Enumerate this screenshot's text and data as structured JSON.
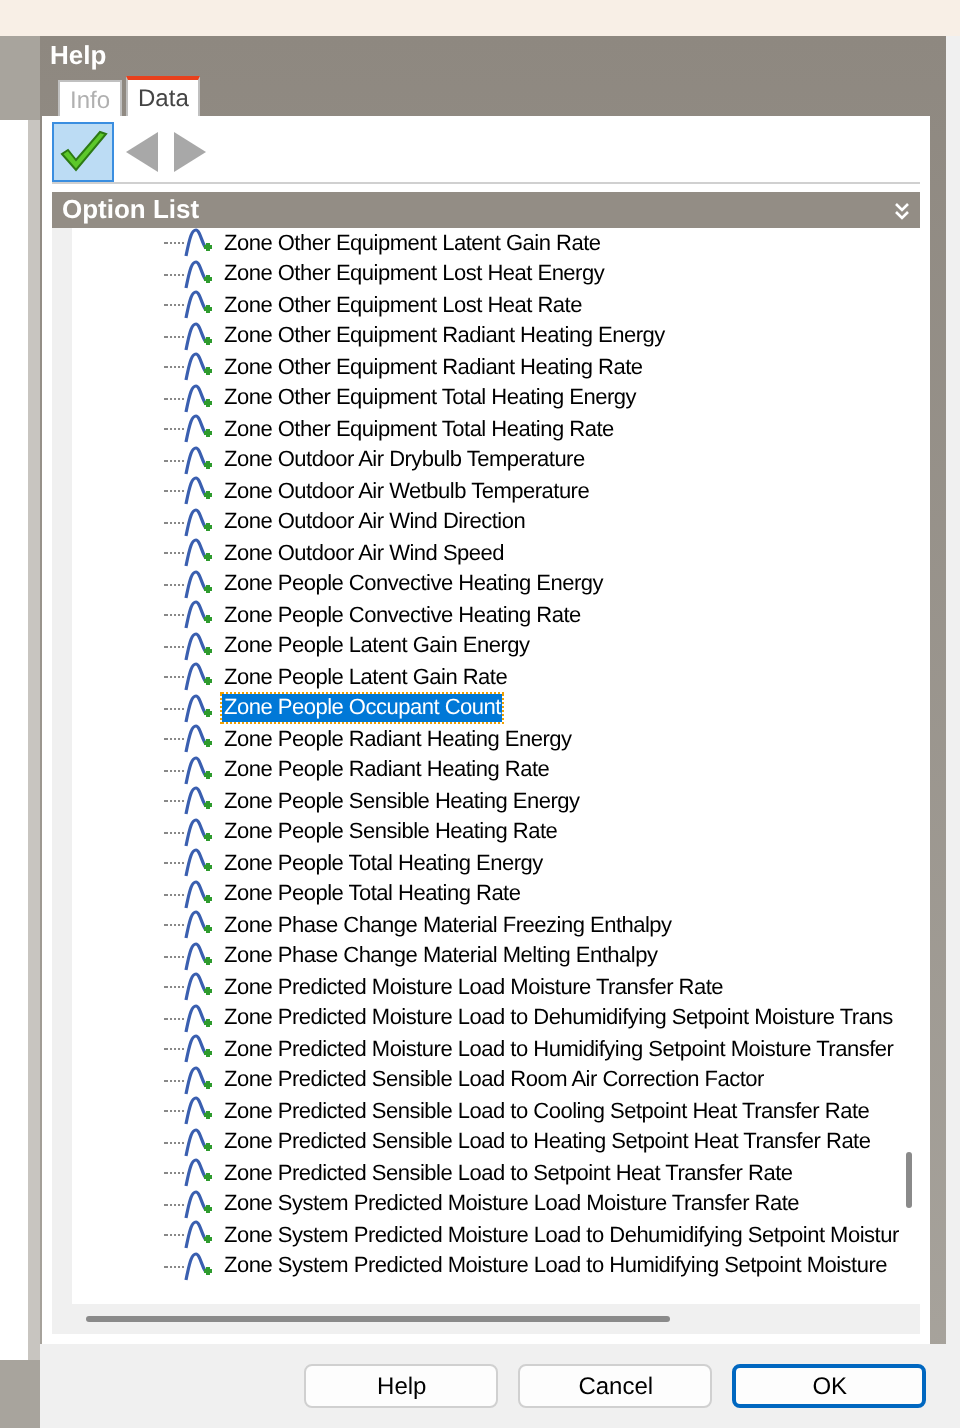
{
  "panel": {
    "title": "Help"
  },
  "tabs": [
    {
      "label": "Info",
      "selected": false
    },
    {
      "label": "Data",
      "selected": true
    }
  ],
  "toolbar": {
    "apply_selected": true
  },
  "option_list": {
    "title": "Option List",
    "items": [
      {
        "label": "Zone Other Equipment Latent Gain Rate",
        "selected": false
      },
      {
        "label": "Zone Other Equipment Lost Heat Energy",
        "selected": false
      },
      {
        "label": "Zone Other Equipment Lost Heat Rate",
        "selected": false
      },
      {
        "label": "Zone Other Equipment Radiant Heating Energy",
        "selected": false
      },
      {
        "label": "Zone Other Equipment Radiant Heating Rate",
        "selected": false
      },
      {
        "label": "Zone Other Equipment Total Heating Energy",
        "selected": false
      },
      {
        "label": "Zone Other Equipment Total Heating Rate",
        "selected": false
      },
      {
        "label": "Zone Outdoor Air Drybulb Temperature",
        "selected": false
      },
      {
        "label": "Zone Outdoor Air Wetbulb Temperature",
        "selected": false
      },
      {
        "label": "Zone Outdoor Air Wind Direction",
        "selected": false
      },
      {
        "label": "Zone Outdoor Air Wind Speed",
        "selected": false
      },
      {
        "label": "Zone People Convective Heating Energy",
        "selected": false
      },
      {
        "label": "Zone People Convective Heating Rate",
        "selected": false
      },
      {
        "label": "Zone People Latent Gain Energy",
        "selected": false
      },
      {
        "label": "Zone People Latent Gain Rate",
        "selected": false
      },
      {
        "label": "Zone People Occupant Count",
        "selected": true
      },
      {
        "label": "Zone People Radiant Heating Energy",
        "selected": false
      },
      {
        "label": "Zone People Radiant Heating Rate",
        "selected": false
      },
      {
        "label": "Zone People Sensible Heating Energy",
        "selected": false
      },
      {
        "label": "Zone People Sensible Heating Rate",
        "selected": false
      },
      {
        "label": "Zone People Total Heating Energy",
        "selected": false
      },
      {
        "label": "Zone People Total Heating Rate",
        "selected": false
      },
      {
        "label": "Zone Phase Change Material Freezing Enthalpy",
        "selected": false
      },
      {
        "label": "Zone Phase Change Material Melting Enthalpy",
        "selected": false
      },
      {
        "label": "Zone Predicted Moisture Load Moisture Transfer Rate",
        "selected": false
      },
      {
        "label": "Zone Predicted Moisture Load to Dehumidifying Setpoint Moisture Trans",
        "selected": false
      },
      {
        "label": "Zone Predicted Moisture Load to Humidifying Setpoint Moisture Transfer",
        "selected": false
      },
      {
        "label": "Zone Predicted Sensible Load Room Air Correction Factor",
        "selected": false
      },
      {
        "label": "Zone Predicted Sensible Load to Cooling Setpoint Heat Transfer Rate",
        "selected": false
      },
      {
        "label": "Zone Predicted Sensible Load to Heating Setpoint Heat Transfer Rate",
        "selected": false
      },
      {
        "label": "Zone Predicted Sensible Load to Setpoint Heat Transfer Rate",
        "selected": false
      },
      {
        "label": "Zone System Predicted Moisture Load Moisture Transfer Rate",
        "selected": false
      },
      {
        "label": "Zone System Predicted Moisture Load to Dehumidifying Setpoint Moistur",
        "selected": false
      },
      {
        "label": "Zone System Predicted Moisture Load to Humidifying Setpoint Moisture",
        "selected": false
      }
    ]
  },
  "buttons": [
    {
      "label": "Help",
      "kind": "normal"
    },
    {
      "label": "Cancel",
      "kind": "normal"
    },
    {
      "label": "OK",
      "kind": "default"
    }
  ]
}
